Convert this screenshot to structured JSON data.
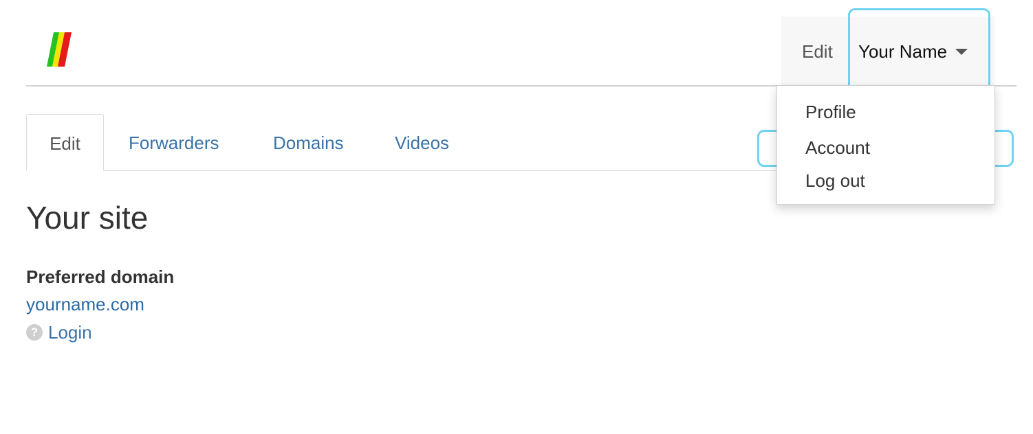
{
  "header": {
    "logo_icon": "striped-logo-icon",
    "logo_colors": [
      "#22c322",
      "#f2e600",
      "#e51a1a"
    ],
    "nav": {
      "edit_label": "Edit",
      "user_label": "Your Name",
      "caret_icon": "caret-down-icon"
    }
  },
  "user_menu": {
    "items": [
      {
        "label": "Profile"
      },
      {
        "label": "Account"
      },
      {
        "label": "Log out"
      }
    ]
  },
  "tabs": [
    {
      "label": "Edit",
      "active": true
    },
    {
      "label": "Forwarders",
      "active": false
    },
    {
      "label": "Domains",
      "active": false
    },
    {
      "label": "Videos",
      "active": false
    }
  ],
  "main": {
    "title": "Your site",
    "preferred_domain_label": "Preferred domain",
    "domain_value": "yourname.com",
    "help_icon": "question-circle-icon",
    "help_icon_glyph": "?",
    "login_label": "Login"
  },
  "colors": {
    "link": "#3a73a8",
    "highlight": "#6fd3f2"
  }
}
